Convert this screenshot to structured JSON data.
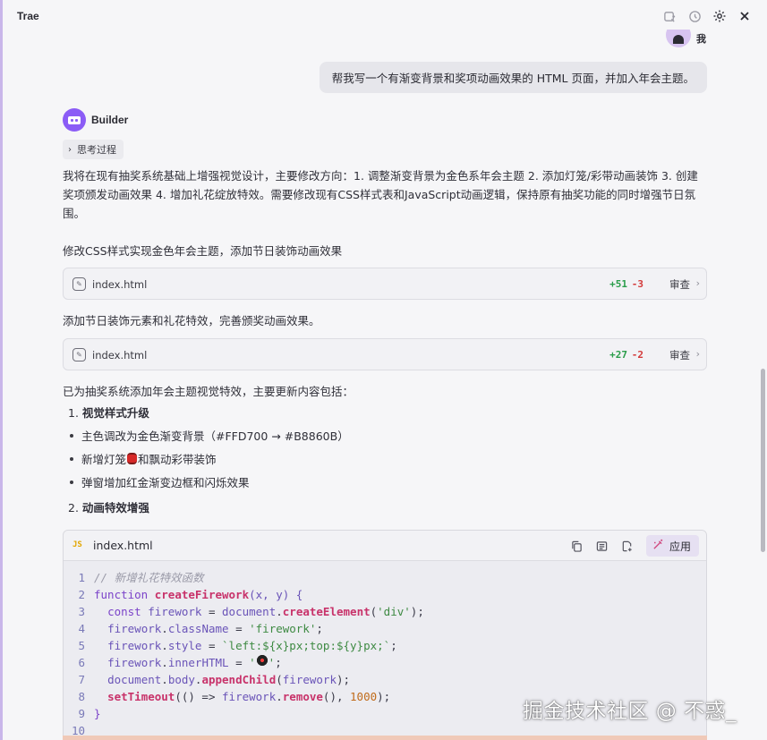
{
  "app": {
    "title": "Trae"
  },
  "titlebar": {
    "icons": [
      "new-chat-icon",
      "history-icon",
      "settings-icon",
      "close-icon"
    ]
  },
  "user": {
    "name": "我",
    "message": "帮我写一个有渐变背景和奖项动画效果的 HTML 页面，并加入年会主题。"
  },
  "bot": {
    "name": "Builder",
    "thinking_label": "思考过程",
    "intro": "我将在现有抽奖系统基础上增强视觉设计，主要修改方向：1. 调整渐变背景为金色系年会主题 2. 添加灯笼/彩带动画装饰 3. 创建奖项颁发动画效果 4. 增加礼花绽放特效。需要修改现有CSS样式表和JavaScript动画逻辑，保持原有抽奖功能的同时增强节日氛围。",
    "step1": "修改CSS样式实现金色年会主题，添加节日装饰动画效果",
    "step2": "添加节日装饰元素和礼花特效，完善颁奖动画效果。",
    "summary": "已为抽奖系统添加年会主题视觉特效，主要更新内容包括："
  },
  "file_changes": [
    {
      "file": "index.html",
      "additions": "+51",
      "deletions": "-3",
      "view_label": "审查"
    },
    {
      "file": "index.html",
      "additions": "+27",
      "deletions": "-2",
      "view_label": "审查"
    }
  ],
  "list": {
    "item1_num": "1.",
    "item1_title": "视觉样式升级",
    "bullets": [
      "主色调改为金色渐变背景（#FFD700 → #B8860B）",
      "新增灯笼",
      "和飘动彩带装饰",
      "弹窗增加红金渐变边框和闪烁效果"
    ],
    "item2_num": "2.",
    "item2_title": "动画特效增强"
  },
  "code_block": {
    "badge": "JS",
    "filename": "index.html",
    "apply_label": "应用",
    "line_numbers": [
      "1",
      "2",
      "3",
      "4",
      "5",
      "6",
      "7",
      "8",
      "9",
      "10"
    ],
    "tokens": {
      "l1": "// 新增礼花特效函数",
      "l2_kw": "function",
      "l2_fn": "createFirework",
      "l2_rest": "(x, y) {",
      "l3_kw": "const",
      "l3_var": "firework",
      "l3_eq": " = ",
      "l3_obj": "document",
      "l3_fn": "createElement",
      "l3_str": "'div'",
      "l4_var": "firework",
      "l4_prop": "className",
      "l4_str": "'firework'",
      "l5_var": "firework",
      "l5_prop": "style",
      "l5_str": "`left:${x}px;top:${y}px;`",
      "l6_var": "firework",
      "l6_prop": "innerHTML",
      "l6_str_open": "'",
      "l6_str_close": "'",
      "l7_obj": "document",
      "l7_prop": "body",
      "l7_fn": "appendChild",
      "l7_arg": "firework",
      "l8_fn": "setTimeout",
      "l8_mid": "(() => ",
      "l8_var": "firework",
      "l8_fn2": "remove",
      "l8_num": "1000",
      "l9": "}"
    }
  },
  "watermark": "掘金技术社区 @ 不惑_"
}
